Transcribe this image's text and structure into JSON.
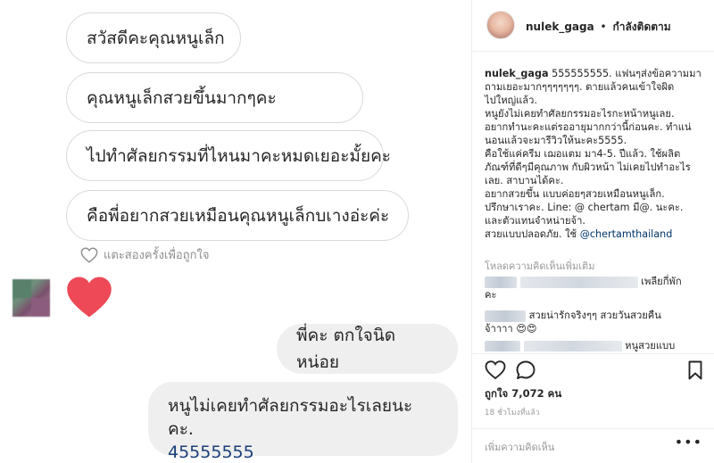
{
  "chat": {
    "outgoing": [
      "สวัสดีคะคุณหนูเล็ก",
      "คุณหนูเล็กสวยขึ้นมากๆคะ",
      "ไปทำศัลยกรรมที่ไหนมาคะหมดเยอะมั้ยคะ",
      "คือพี่อยากสวยเหมือนคุณหนูเล็กบเางอ่ะค่ะ"
    ],
    "like_hint": "แตะสองครั้งเพื่อถูกใจ",
    "incoming": {
      "reply1": "พี่คะ ตกใจนิดหน่อย",
      "reply2_line1": "หนูไม่เคยทำศัลยกรรมอะไรเลยนะคะ.",
      "reply2_line2": "45555555"
    },
    "colors": {
      "heart": "#ed4956",
      "bubble_in": "#efefef",
      "bubble_out_border": "#d9d9d9"
    }
  },
  "instagram": {
    "header": {
      "username": "nulek_gaga",
      "separator": "•",
      "follow_status": "กำลังติดตาม"
    },
    "caption": {
      "username": "nulek_gaga",
      "line1_text": " 555555555. แฟนๆส่งข้อความมา",
      "lines": [
        "ถามเยอะมากๆๆๆๆๆๆๆ. ตายแล้วคนเข้าใจผิด",
        "ไปใหญ่แล้ว.",
        "หนูยังไม่เคยทำศัลยกรรมอะไรกะหน้าหนูเลย.",
        "อยากทำนะคะแต่รออายุมากกว่านี้ก่อนคะ. ทำแน่",
        "นอนแล้วจะมารีวิวให้นะคะ5555.",
        "คือใช้แค่ครีม เฌอแตม มา4-5. ปีแล้ว. ใช้ผลิต",
        "ภัณฑ์ที่ดีๆมีคุณภาพ กับผิวหน้า ไม่เคยไปทำอะไร",
        "เลย. สาบานได้คะ.",
        "อยากสวยขึ้น แบบค่อยๆสวยเหมือนหนูเล็ก.",
        "ปรึกษาเราคะ. Line: @ chertam มี@. นะคะ.",
        "และตัวแทนจำหน่ายจ้า."
      ],
      "last_line_text": "สวยแบบปลอดภัย. ใช้ ",
      "mention": "@chertamthailand"
    },
    "load_more": "โหลดความคิดเห็นเพิ่มเติม",
    "comments": [
      {
        "line1_tail": "เพลียกี่พัก",
        "line2": "คะ"
      },
      {
        "line1_tail": "สวยน่ารักจริงๆๆ สวยวันสวยคืน",
        "line2": "จ้าาาา 😍😍"
      },
      {
        "line1_tail": "หนูสวยแบบ"
      }
    ],
    "likes": "ถูกใจ 7,072 คน",
    "time_ago": "18 ชั่วโมงที่แล้ว",
    "add_comment_placeholder": "เพิ่มความคิดเห็น",
    "more_label": "•••",
    "icons": [
      "heart-outline-icon",
      "comment-icon",
      "bookmark-icon",
      "more-icon"
    ]
  }
}
